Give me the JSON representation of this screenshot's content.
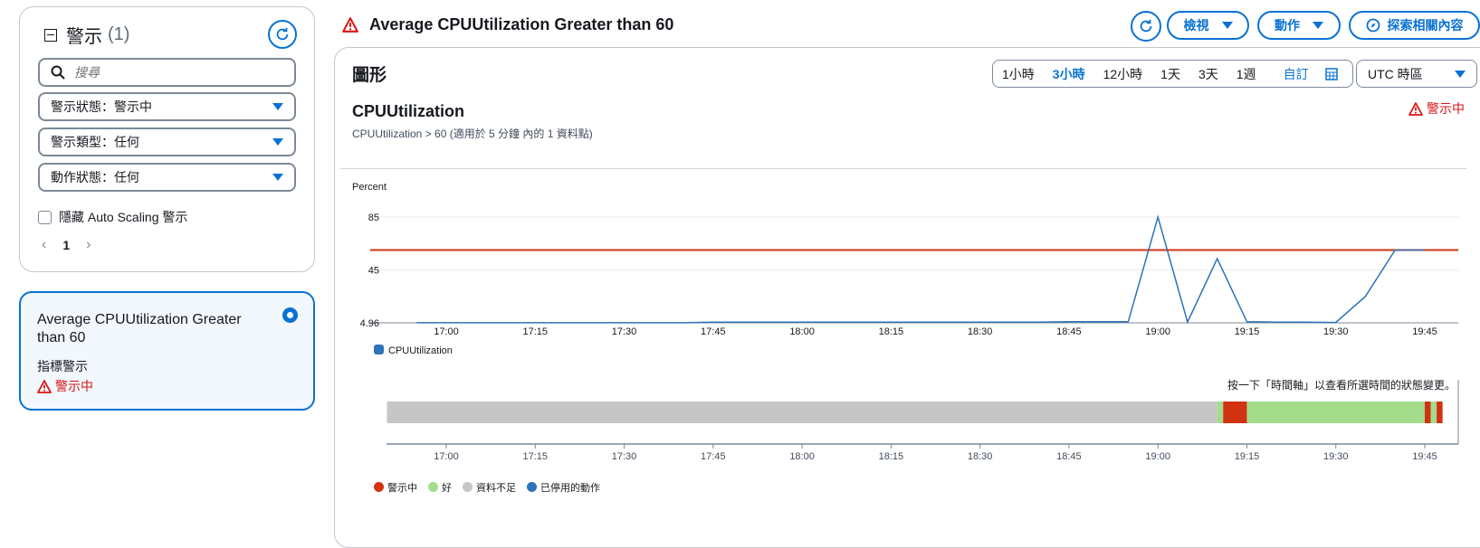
{
  "filter_panel": {
    "title": "警示",
    "count": "(1)",
    "search_placeholder": "搜尋",
    "state_filter": "警示狀態：警示中",
    "type_filter": "警示類型：任何",
    "action_filter": "動作狀態：任何",
    "hide_autoscaling_label": "隱藏 Auto Scaling 警示",
    "page_number": "1"
  },
  "alarm_card": {
    "title": "Average CPUUtilization Greater than 60",
    "type": "指標警示",
    "status": "警示中"
  },
  "header": {
    "title": "Average CPUUtilization Greater than 60",
    "view_button": "檢視",
    "actions_button": "動作",
    "explore_button": "探索相關內容"
  },
  "graph": {
    "section_title": "圖形",
    "time_ranges": [
      "1小時",
      "3小時",
      "12小時",
      "1天",
      "3天",
      "1週"
    ],
    "selected_range": "3小時",
    "custom_label": "自訂",
    "timezone": "UTC 時區",
    "metric_title": "CPUUtilization",
    "metric_subtitle": "CPUUtilization > 60 (適用於 5 分鐘 內的 1 資料點)",
    "alarm_status": "警示中",
    "timeline_hint": "按一下「時間軸」以查看所選時間的狀態變更。"
  },
  "colors": {
    "alarm": "#d13212",
    "ok": "#a4dc8c",
    "insufficient": "#c6c6c6",
    "disabled": "#2e73b8",
    "series": "#2e73b8",
    "threshold": "#d13212",
    "accent": "#0972d3"
  },
  "chart_data": [
    {
      "type": "line",
      "ylabel": "Percent",
      "yticks": [
        4.96,
        45,
        85
      ],
      "ylim": [
        4.96,
        85
      ],
      "xticks": [
        "17:00",
        "17:15",
        "17:30",
        "17:45",
        "18:00",
        "18:15",
        "18:30",
        "18:45",
        "19:00",
        "19:15",
        "19:30",
        "19:45"
      ],
      "threshold": 60,
      "legend_placement": "bottom-left",
      "series": [
        {
          "name": "CPUUtilization",
          "x": [
            "16:55",
            "17:00",
            "17:05",
            "17:10",
            "17:15",
            "17:20",
            "17:25",
            "17:30",
            "17:35",
            "17:40",
            "17:45",
            "17:50",
            "17:55",
            "18:00",
            "18:05",
            "18:10",
            "18:15",
            "18:20",
            "18:25",
            "18:30",
            "18:35",
            "18:40",
            "18:45",
            "18:50",
            "18:55",
            "19:00",
            "19:05",
            "19:10",
            "19:15",
            "19:20",
            "19:25",
            "19:30",
            "19:35",
            "19:40",
            "19:45"
          ],
          "values": [
            5,
            5,
            5,
            5,
            5,
            5,
            5,
            5,
            5,
            5,
            5.5,
            5.5,
            5.5,
            5.5,
            5.5,
            5.5,
            5.5,
            5.5,
            5.5,
            5.5,
            5.5,
            5.5,
            5.8,
            5.8,
            5.8,
            85,
            5.5,
            53.5,
            5.8,
            5.5,
            5.5,
            5.2,
            25,
            60,
            60
          ]
        }
      ]
    },
    {
      "type": "timeline",
      "xticks": [
        "17:00",
        "17:15",
        "17:30",
        "17:45",
        "18:00",
        "18:15",
        "18:30",
        "18:45",
        "19:00",
        "19:15",
        "19:30",
        "19:45"
      ],
      "legend": [
        "警示中",
        "好",
        "資料不足",
        "已停用的動作"
      ],
      "segments": [
        {
          "state": "insufficient",
          "start": "16:50",
          "end": "19:10"
        },
        {
          "state": "ok",
          "start": "19:10",
          "end": "19:11"
        },
        {
          "state": "alarm",
          "start": "19:11",
          "end": "19:15"
        },
        {
          "state": "ok",
          "start": "19:15",
          "end": "19:45"
        },
        {
          "state": "alarm",
          "start": "19:45",
          "end": "19:46"
        },
        {
          "state": "ok",
          "start": "19:46",
          "end": "19:47"
        },
        {
          "state": "alarm",
          "start": "19:47",
          "end": "19:48"
        }
      ]
    }
  ]
}
